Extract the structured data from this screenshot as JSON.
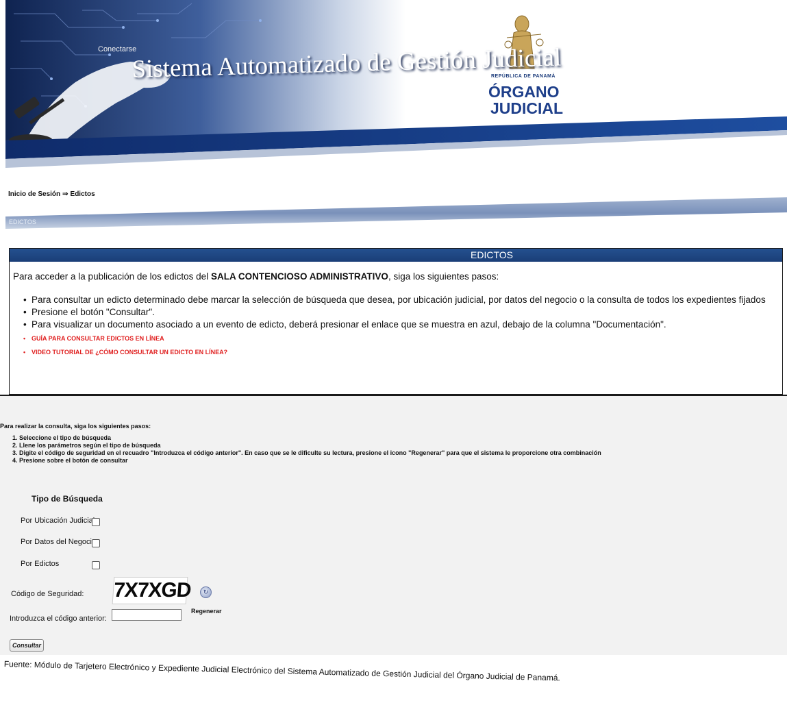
{
  "header": {
    "connect_label": "Conectarse",
    "system_title": "Sistema Automatizado de Gestión Judicial",
    "logo": {
      "top_text": "REPÚBLICA DE PANAMÁ",
      "line1": "ÓRGANO",
      "line2": "JUDICIAL"
    }
  },
  "breadcrumb": {
    "items": [
      "Inicio de Sesión",
      "Edictos"
    ],
    "separator": "⇒"
  },
  "section_bar": {
    "label": "EDICTOS"
  },
  "instructions": {
    "heading": "EDICTOS",
    "intro_pre": "Para acceder a la publicación de los edictos del ",
    "intro_bold": "SALA CONTENCIOSO ADMINISTRATIVO",
    "intro_post": ", siga los siguientes pasos:",
    "steps": [
      "Para consultar un edicto determinado debe marcar la selección de búsqueda que desea, por ubicación judicial, por datos del negocio o la consulta de todos los expedientes fijados",
      "Presione el botón \"Consultar\".",
      "Para visualizar un documento asociado a un evento de edicto, deberá presionar el enlace que se muestra en azul, debajo de la columna \"Documentación\"."
    ],
    "links": [
      "GUÍA PARA CONSULTAR EDICTOS EN LÍNEA",
      "VIDEO TUTORIAL DE ¿CÓMO CONSULTAR UN EDICTO EN LÍNEA?"
    ]
  },
  "form": {
    "intro": "Para realizar la consulta, siga los siguientes pasos:",
    "steps": [
      "1. Seleccione el tipo de búsqueda",
      "2. Llene los parámetros según el tipo de búsqueda",
      "3. Digite el código de seguridad en el recuadro \"Introduzca el código anterior\". En caso que se le dificulte su lectura, presione el icono \"Regenerar\" para que el sistema le proporcione otra combinación",
      "4. Presione sobre el botón de consultar"
    ],
    "tipo_title": "Tipo de Búsqueda",
    "options": [
      {
        "label": "Por Ubicación Judicial",
        "checked": false
      },
      {
        "label": "Por Datos del Negocio",
        "checked": false
      },
      {
        "label": "Por Edictos",
        "checked": false
      }
    ],
    "security_label": "Código de Seguridad:",
    "captcha_text": "7X7XGD",
    "regenerate_label": "Regenerar",
    "input_label": "Introduzca el código anterior:",
    "input_value": "",
    "submit_label": "Consultar"
  },
  "footer": {
    "source": "Fuente: Módulo de Tarjetero Electrónico y Expediente Judicial Electrónico del Sistema Automatizado de Gestión Judicial del Órgano Judicial de Panamá."
  },
  "colors": {
    "header_blue": "#1a3e77",
    "link_red": "#e02020",
    "panel_gray": "#f2f2f2"
  }
}
